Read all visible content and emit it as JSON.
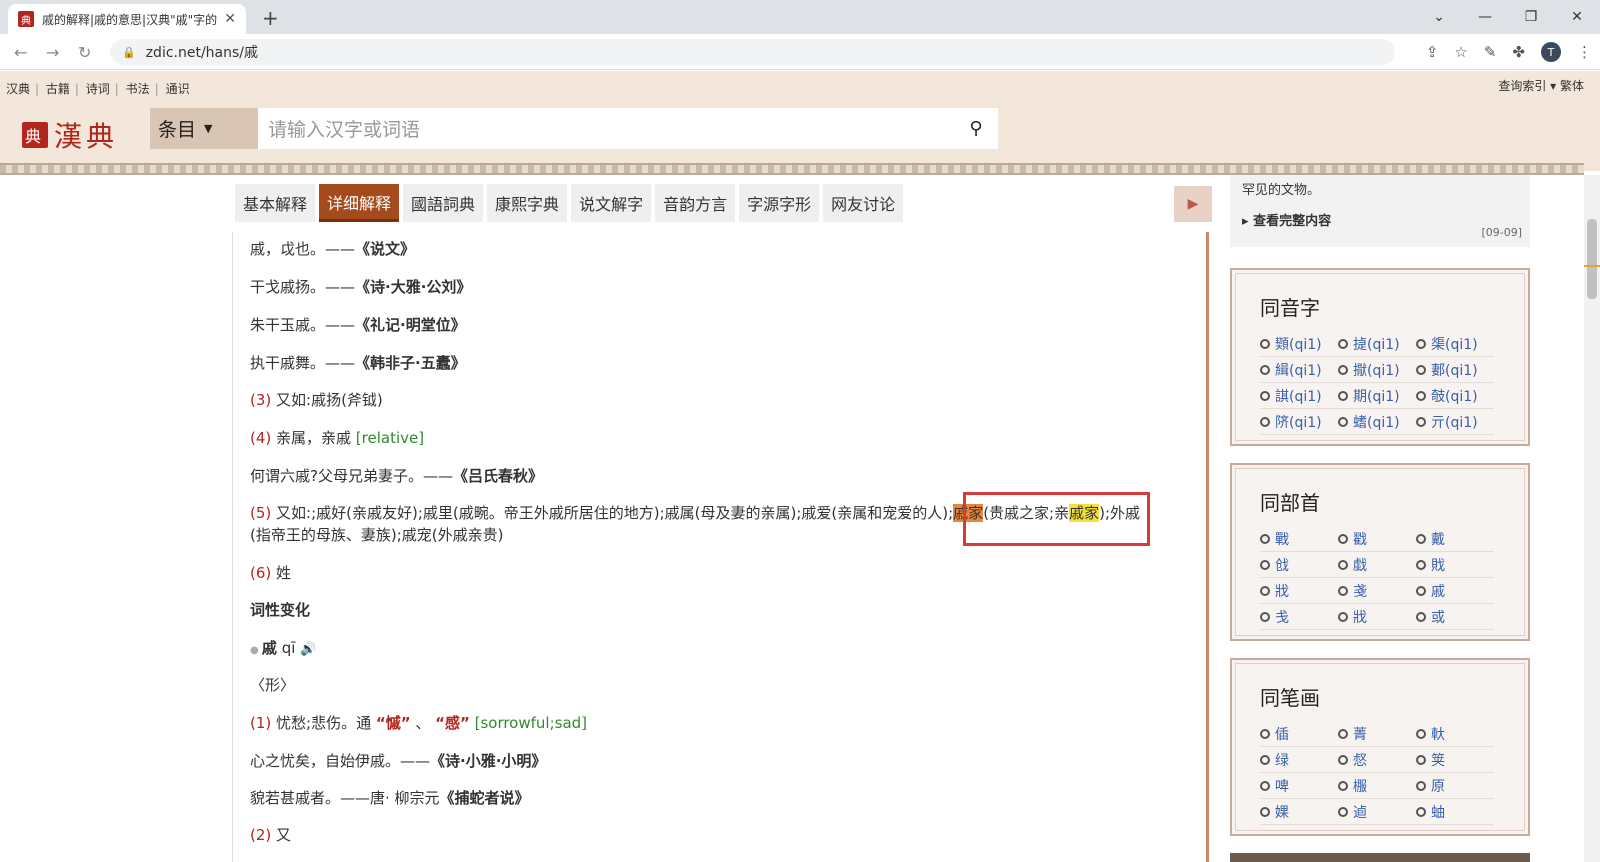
{
  "browser": {
    "tab_title": "戚的解释|戚的意思|汉典\"戚\"字的...",
    "url": "zdic.net/hans/戚",
    "new_tab": "+",
    "avatar_letter": "T"
  },
  "site": {
    "toplinks": [
      "汉典",
      "古籍",
      "诗词",
      "书法",
      "通识"
    ],
    "topright": "查询索引 ▾ 繁体",
    "logo_text": "漢典",
    "logo_seal": "典",
    "search_select": "条目",
    "search_placeholder": "请输入汉字或词语"
  },
  "tabs": [
    "基本解释",
    "详细解释",
    "國語詞典",
    "康熙字典",
    "说文解字",
    "音韵方言",
    "字源字形",
    "网友讨论"
  ],
  "active_tab": "详细解释",
  "content": {
    "l1a": "戚，戉也。——",
    "l1b": "《说文》",
    "l2a": "干戈戚扬。——",
    "l2b": "《诗·大雅·公刘》",
    "l3a": "朱干玉戚。——",
    "l3b": "《礼记·明堂位》",
    "l4a": "执干戚舞。——",
    "l4b": "《韩非子·五蠹》",
    "l5n": "(3)",
    "l5": " 又如:戚扬(斧钺)",
    "l6n": "(4)",
    "l6": " 亲属，亲戚 ",
    "l6e": "[relative]",
    "l7a": "何谓六戚?父母兄弟妻子。——",
    "l7b": "《吕氏春秋》",
    "l8n": "(5)",
    "l8a": " 又如:;戚好(亲戚友好);戚里(戚畹。帝王外戚所居住的地方);戚属(母及妻的亲属);戚爱(亲属和宠爱的人);",
    "l8hl1": "戚家",
    "l8b": "(贵戚之家;亲",
    "l8hl2": "戚家",
    "l8c": ");外戚",
    "l9": "(指帝王的母族、妻族);戚宠(外戚亲贵)",
    "l10n": "(6)",
    "l10": " 姓",
    "l11": "词性变化",
    "l12a": "戚",
    "l12b": " qī ",
    "l13": "〈形〉",
    "l14n": "(1)",
    "l14a": " 忧愁;悲伤。通 ",
    "l14b": "“慽”",
    "l14c": " 、 ",
    "l14d": "“感”",
    "l14e": "  [sorrowful;sad]",
    "l15a": "心之忧矣，自始伊戚。——",
    "l15b": "《诗·小雅·小明》",
    "l16a": "貌若甚戚者。——唐· 柳宗元",
    "l16b": "《捕蛇者说》",
    "l17n": "(2)",
    "l17": " 又"
  },
  "sidebar": {
    "snip_text": "罕见的文物。",
    "snip_more": "查看完整内容",
    "snip_date": "[09-09]",
    "tongyin_title": "同音字",
    "tongyin": [
      "䫔(qi1)",
      "㨗(qi1)",
      "㮡(qi1)",
      "緝(qi1)",
      "㩎(qi1)",
      "郪(qi1)",
      "諆(qi1)",
      "期(qi1)",
      "攲(qi1)",
      "𬯀(qi1)",
      "螧(qi1)",
      "亓(qi1)"
    ],
    "tongbushou_title": "同部首",
    "tongbushou": [
      "戰",
      "戳",
      "戴",
      "戗",
      "戱",
      "戝",
      "戕",
      "戔",
      "戚",
      "戋",
      "戕",
      "或"
    ],
    "tongbihua_title": "同笔画",
    "tongbihua": [
      "偛",
      "菁",
      "軑",
      "绿",
      "惄",
      "䇲",
      "啤",
      "棴",
      "原",
      "婐",
      "逌",
      "蚰"
    ]
  }
}
